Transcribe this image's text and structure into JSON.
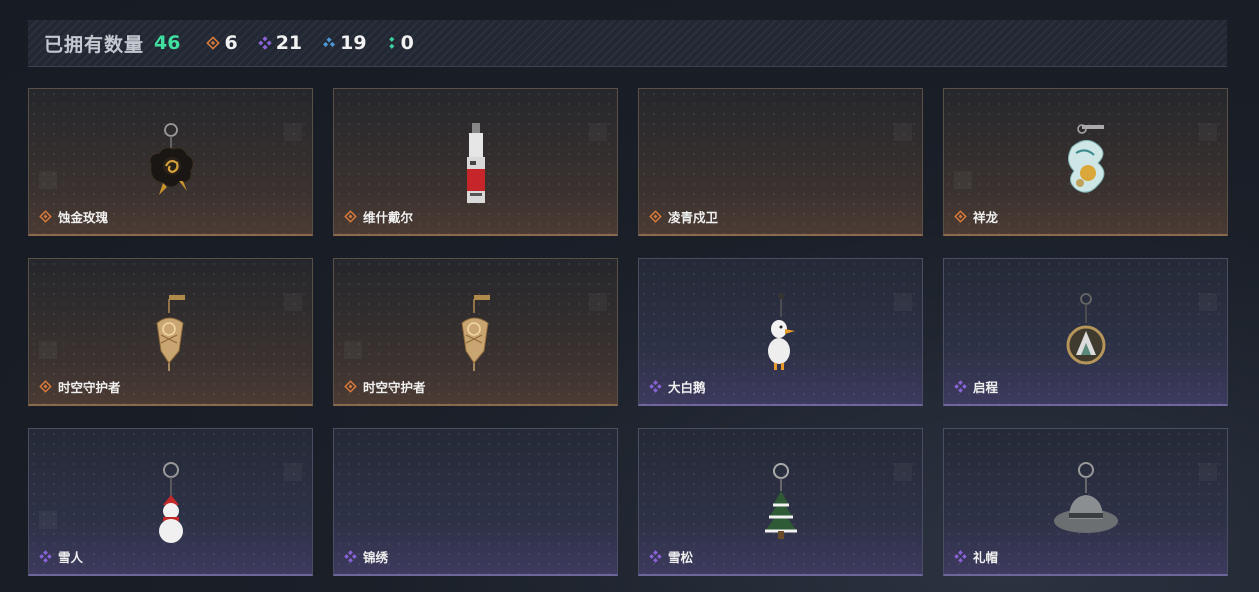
{
  "header": {
    "owned_label": "已拥有数量",
    "owned_count": "46",
    "stats": [
      {
        "icon": "orange-rarity-icon",
        "value": "6",
        "color": "#d97a3a"
      },
      {
        "icon": "purple-rarity-icon",
        "value": "21",
        "color": "#8a62d8"
      },
      {
        "icon": "blue-rarity-icon",
        "value": "19",
        "color": "#4a9ad8"
      },
      {
        "icon": "green-rarity-icon",
        "value": "0",
        "color": "#3fd0a0"
      }
    ]
  },
  "colors": {
    "orange": "#d97a3a",
    "purple": "#8a62d8",
    "owned_count": "#3fe0a0"
  },
  "items": [
    {
      "name": "蚀金玫瑰",
      "rarity": "orange",
      "icon": "black-rose-charm-icon"
    },
    {
      "name": "维什戴尔",
      "rarity": "orange",
      "icon": "red-tag-charm-icon"
    },
    {
      "name": "凌青戍卫",
      "rarity": "orange",
      "icon": ""
    },
    {
      "name": "祥龙",
      "rarity": "orange",
      "icon": "dragon-charm-icon"
    },
    {
      "name": "时空守护者",
      "rarity": "orange",
      "icon": "golden-guardian-charm-icon"
    },
    {
      "name": "时空守护者",
      "rarity": "orange",
      "icon": "golden-guardian-charm-icon"
    },
    {
      "name": "大白鹅",
      "rarity": "purple",
      "icon": "white-goose-charm-icon"
    },
    {
      "name": "启程",
      "rarity": "purple",
      "icon": "medal-charm-icon"
    },
    {
      "name": "雪人",
      "rarity": "purple",
      "icon": "snowman-charm-icon"
    },
    {
      "name": "锦绣",
      "rarity": "purple",
      "icon": ""
    },
    {
      "name": "雪松",
      "rarity": "purple",
      "icon": "snowy-pine-charm-icon"
    },
    {
      "name": "礼帽",
      "rarity": "purple",
      "icon": "fedora-hat-charm-icon"
    }
  ]
}
